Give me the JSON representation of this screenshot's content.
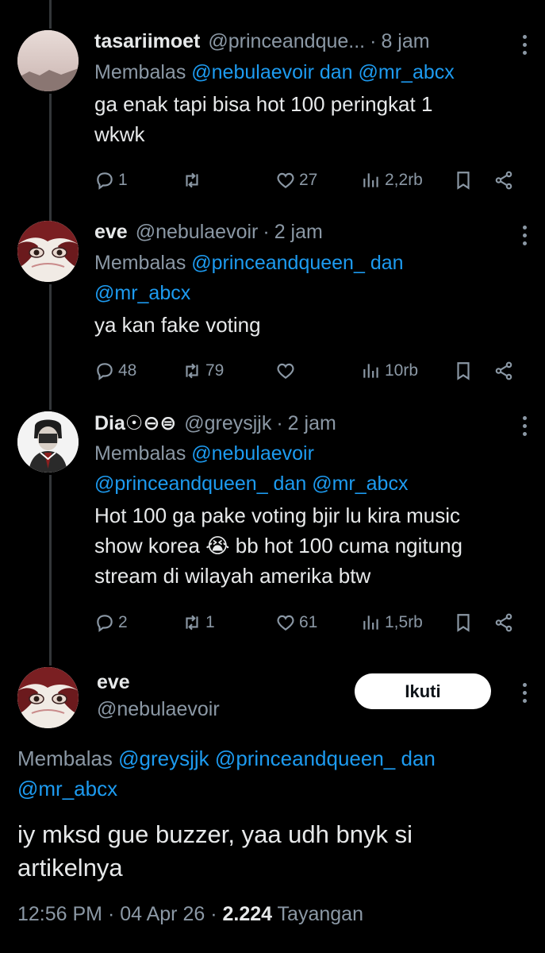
{
  "tweets": [
    {
      "name": "tasariimoet",
      "handle": "@princeandque...",
      "time": "8 jam",
      "replying_prefix": "Membalas ",
      "mentions": [
        "@nebulaevoir",
        " dan ",
        "@mr_abcx"
      ],
      "text_lines": [
        "ga enak tapi bisa hot 100 peringkat 1",
        "wkwk"
      ],
      "replies": "1",
      "reposts": "",
      "likes": "27",
      "views": "2,2rb"
    },
    {
      "name": "eve",
      "handle": "@nebulaevoir",
      "time": "2 jam",
      "replying_prefix": "Membalas ",
      "mentions": [
        "@princeandqueen_",
        " dan ",
        "@mr_abcx"
      ],
      "text_lines": [
        "ya kan fake voting"
      ],
      "replies": "48",
      "reposts": "79",
      "likes": "",
      "views": "10rb"
    },
    {
      "name": "Dia☉⊖⊜",
      "handle": "@greysjjk",
      "time": "2 jam",
      "replying_prefix": "Membalas ",
      "mentions": [
        "@nebulaevoir",
        "@princeandqueen_",
        " dan ",
        "@mr_abcx"
      ],
      "text_lines": [
        "Hot 100 ga pake voting bjir lu kira music",
        "show korea 😭 bb hot 100 cuma ngitung",
        "stream di wilayah amerika btw"
      ],
      "replies": "2",
      "reposts": "1",
      "likes": "61",
      "views": "1,5rb"
    }
  ],
  "main": {
    "name": "eve",
    "handle": "@nebulaevoir",
    "follow_label": "Ikuti",
    "replying_prefix": "Membalas ",
    "mentions": [
      "@greysjjk",
      "@princeandqueen_",
      " dan ",
      "@mr_abcx"
    ],
    "text_lines": [
      "iy mksd gue buzzer, yaa udh bnyk si",
      "artikelnya"
    ],
    "time": "12:56 PM",
    "sep": " · ",
    "date": "04 Apr 26",
    "views": "2.224",
    "views_label": "Tayangan"
  },
  "colors": {
    "background": "#000000",
    "text": "#e7e9ea",
    "muted": "#8b98a5",
    "link": "#1d9bf0"
  }
}
